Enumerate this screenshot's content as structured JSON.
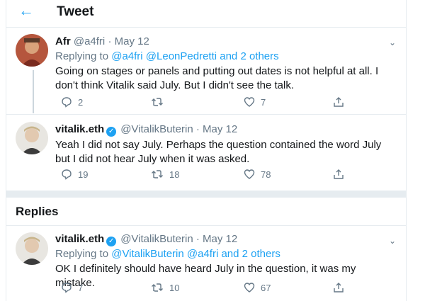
{
  "header": {
    "title": "Tweet"
  },
  "tweets": [
    {
      "name": "Afr",
      "handle": "@a4fri",
      "date": "· May 12",
      "replying_label": "Replying to",
      "replying_users": "@a4fri @LeonPedretti and 2 others",
      "text": "Going on stages or panels and putting out dates is not helpful at all. I don't think Vitalik said July. But I didn't see the talk.",
      "replies": "2",
      "retweets": "",
      "likes": "7"
    },
    {
      "name": "vitalik.eth",
      "handle": "@VitalikButerin",
      "date": "· May 12",
      "text": "Yeah I did not say July. Perhaps the question contained the word July but I did not hear July when it was asked.",
      "replies": "19",
      "retweets": "18",
      "likes": "78"
    }
  ],
  "replies_section": {
    "title": "Replies"
  },
  "reply": {
    "name": "vitalik.eth",
    "handle": "@VitalikButerin",
    "date": "· May 12",
    "replying_label": "Replying to",
    "replying_users": "@VitalikButerin @a4fri and 2 others",
    "text": "OK I definitely should have heard July in the question, it was my mistake.",
    "replies": "7",
    "retweets": "10",
    "likes": "67"
  },
  "colors": {
    "accent": "#1da1f2",
    "muted": "#657786",
    "border": "#e6ecf0"
  }
}
